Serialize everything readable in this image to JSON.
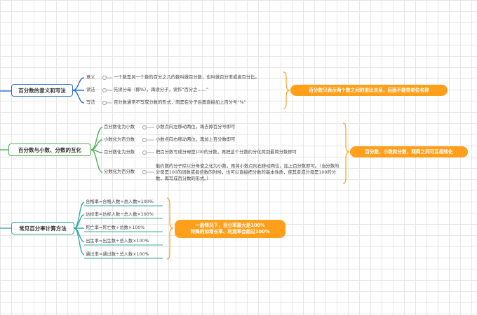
{
  "colors": {
    "blue": "#2b6bd6",
    "green": "#4caf50",
    "teal": "#3aa9a0",
    "orange": "#ff9f1a"
  },
  "sections": [
    {
      "title": "百分数的意义和写法",
      "items": [
        {
          "label": "意义",
          "text": "一个数是另一个数的百分之几的数叫做百分数，也叫做百分率或者百分比。"
        },
        {
          "label": "读法",
          "text": "先读分母（即%），再读分子，读作“百分之……”"
        },
        {
          "label": "写法",
          "text": "百分数通常不写成分数的形式，而是在分子后面直接加上百分号“%”"
        }
      ],
      "callout": "百分数只表示两个数之间的倍比关系，后面不能带单位名称"
    },
    {
      "title": "百分数与小数、分数的互化",
      "items": [
        {
          "label": "百分数化为小数",
          "text": "小数点向左移动两位，再去掉百分号即可"
        },
        {
          "label": "小数化为百分数",
          "text": "小数点向右移动两位，再加上百分数即可"
        },
        {
          "label": "百分数化为分数",
          "text": "把百分数写成分母是100的分数，再把这个分数约分化简到最简分数即可"
        },
        {
          "label": "分数化为百分数",
          "text": "能约数的分子除以分母使之化为小数，再将小数点向右移动两位，加上百分数即可。（当分数的分母是100的因数或者倍数的时候，也可以直接把分数的基本性质，使其变成分母是100的分数，再写成百分数的形式。）"
        }
      ],
      "callout": "百分数、小数和分数，两两之间可互相转化"
    },
    {
      "title": "常见百分率计算方法",
      "items": [
        {
          "text": "合格率=合格人数÷总人数×100%"
        },
        {
          "text": "达标率=达标人数÷总人数×100%"
        },
        {
          "text": "死亡率=死亡数÷总数×100%"
        },
        {
          "text": "出生率=出生数÷总人数×100%"
        },
        {
          "text": "通过率=通过数÷总人数×100%"
        }
      ],
      "callout_lines": [
        "一般情况下，百分率最大是100%",
        "特殊的如增长率、利润率会超过100%"
      ]
    }
  ]
}
